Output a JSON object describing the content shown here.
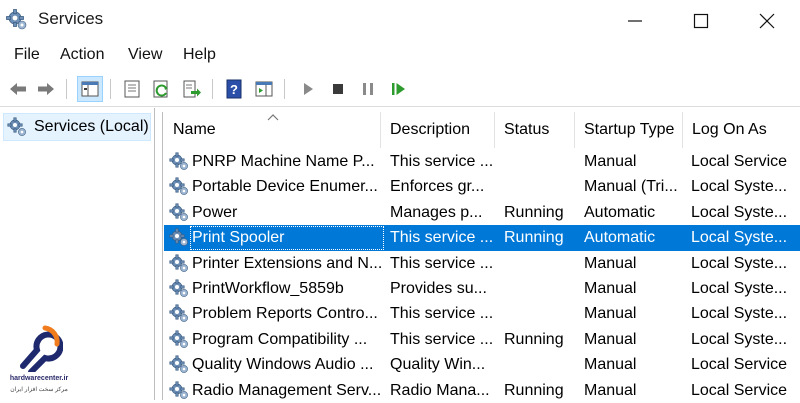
{
  "window": {
    "title": "Services"
  },
  "menu": [
    "File",
    "Action",
    "View",
    "Help"
  ],
  "toolbar": {
    "buttons": [
      "back-arrow-icon",
      "forward-arrow-icon",
      "show-console-tree-icon",
      "properties-icon",
      "refresh-icon",
      "export-list-icon",
      "help-icon",
      "action-pane-icon",
      "start-service-icon",
      "stop-service-icon",
      "pause-service-icon",
      "restart-service-icon"
    ]
  },
  "tree": {
    "label": "Services (Local)"
  },
  "table": {
    "columns": [
      "Name",
      "Description",
      "Status",
      "Startup Type",
      "Log On As"
    ],
    "rows": [
      {
        "name": "PNRP Machine Name P...",
        "description": "This service ...",
        "status": "",
        "startup": "Manual",
        "logon": "Local Service"
      },
      {
        "name": "Portable Device Enumer...",
        "description": "Enforces gr...",
        "status": "",
        "startup": "Manual (Tri...",
        "logon": "Local Syste..."
      },
      {
        "name": "Power",
        "description": "Manages p...",
        "status": "Running",
        "startup": "Automatic",
        "logon": "Local Syste..."
      },
      {
        "name": "Print Spooler",
        "description": "This service ...",
        "status": "Running",
        "startup": "Automatic",
        "logon": "Local Syste..."
      },
      {
        "name": "Printer Extensions and N...",
        "description": "This service ...",
        "status": "",
        "startup": "Manual",
        "logon": "Local Syste..."
      },
      {
        "name": "PrintWorkflow_5859b",
        "description": "Provides su...",
        "status": "",
        "startup": "Manual",
        "logon": "Local Syste..."
      },
      {
        "name": "Problem Reports Contro...",
        "description": "This service ...",
        "status": "",
        "startup": "Manual",
        "logon": "Local Syste..."
      },
      {
        "name": "Program Compatibility ...",
        "description": "This service ...",
        "status": "Running",
        "startup": "Manual",
        "logon": "Local Syste..."
      },
      {
        "name": "Quality Windows Audio ...",
        "description": "Quality Win...",
        "status": "",
        "startup": "Manual",
        "logon": "Local Service"
      },
      {
        "name": "Radio Management Serv...",
        "description": "Radio Mana...",
        "status": "Running",
        "startup": "Manual",
        "logon": "Local Service"
      }
    ],
    "selected_index": 3
  },
  "watermark": {
    "text": "hardwarecenter.ir",
    "subtext": "مرکز سخت افزار ایران"
  },
  "colors": {
    "selection": "#0078d7",
    "tree_selection": "#e5f3ff",
    "gear": "#5a7fa8"
  }
}
